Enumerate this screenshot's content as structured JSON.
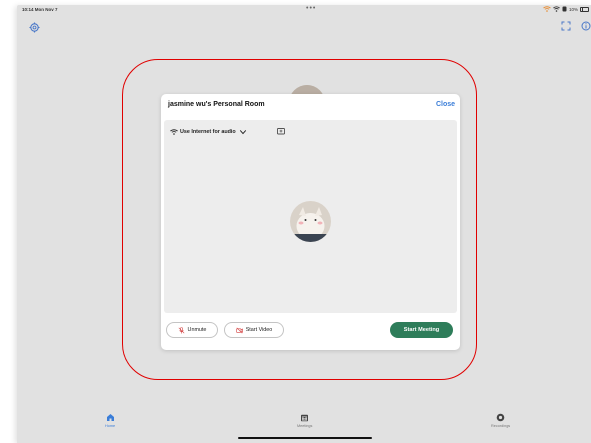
{
  "status_bar": {
    "time_date": "10:14  Mon Nov 7",
    "dots": "•••",
    "battery_text": "10%"
  },
  "modal": {
    "title": "jasmine wu's Personal Room",
    "close_label": "Close",
    "audio_option": "Use Internet for audio",
    "unmute_label": "Unmute",
    "start_video_label": "Start Video",
    "start_meeting_label": "Start Meeting"
  },
  "tabs": [
    {
      "label": "Home",
      "icon": "home-icon",
      "active": true
    },
    {
      "label": "Meetings",
      "icon": "calendar-icon",
      "active": false
    },
    {
      "label": "Recordings",
      "icon": "record-icon",
      "active": false
    }
  ],
  "colors": {
    "accent": "#3a7dd8",
    "start_meeting": "#2e7d5a",
    "highlight": "#e00000",
    "background": "#e1e1e1"
  }
}
